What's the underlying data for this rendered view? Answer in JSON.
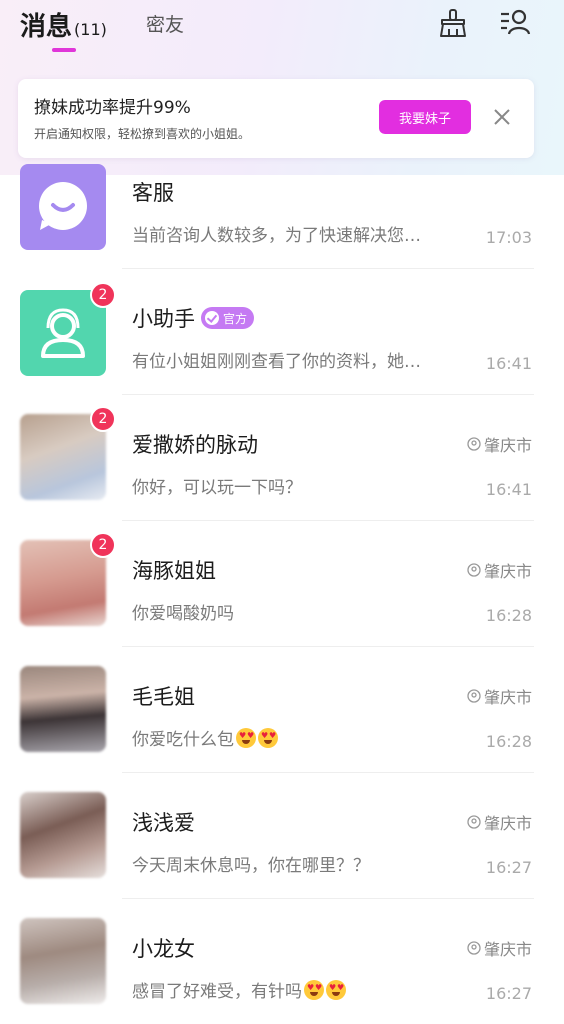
{
  "header": {
    "tab_messages": "消息",
    "tab_messages_count": "(11)",
    "tab_friends": "密友",
    "icon_clean": "broom-icon",
    "icon_contacts": "contacts-icon"
  },
  "banner": {
    "title": "撩妹成功率提升99%",
    "subtitle": "开启通知权限，轻松撩到喜欢的小姐姐。",
    "button": "我要妹子",
    "close_icon": "close-icon"
  },
  "colors": {
    "accent": "#e22ee0",
    "badge": "#f0345a",
    "official_tag": "#c57af3",
    "service_avatar": "#a58af0",
    "assistant_avatar": "#52d6ae"
  },
  "conversations": [
    {
      "name": "客服",
      "preview": "当前咨询人数较多，为了快速解决您…",
      "time": "17:03"
    },
    {
      "name": "小助手",
      "tag": "官方",
      "preview": "有位小姐姐刚刚查看了你的资料，她…",
      "time": "16:41",
      "badge": "2"
    },
    {
      "name": "爱撒娇的脉动",
      "preview": "你好，可以玩一下吗？",
      "time": "16:41",
      "badge": "2",
      "location": "肇庆市"
    },
    {
      "name": "海豚姐姐",
      "preview": "你爱喝酸奶吗",
      "time": "16:28",
      "badge": "2",
      "location": "肇庆市"
    },
    {
      "name": "毛毛姐",
      "preview": "你爱吃什么包",
      "time": "16:28",
      "location": "肇庆市",
      "emoji": "heart-eyes-emoji"
    },
    {
      "name": "浅浅爱",
      "preview": "今天周末休息吗，你在哪里？？",
      "time": "16:27",
      "location": "肇庆市"
    },
    {
      "name": "小龙女",
      "preview": "感冒了好难受，有针吗",
      "time": "16:27",
      "location": "肇庆市",
      "emoji": "smiling-hearts-emoji"
    }
  ]
}
